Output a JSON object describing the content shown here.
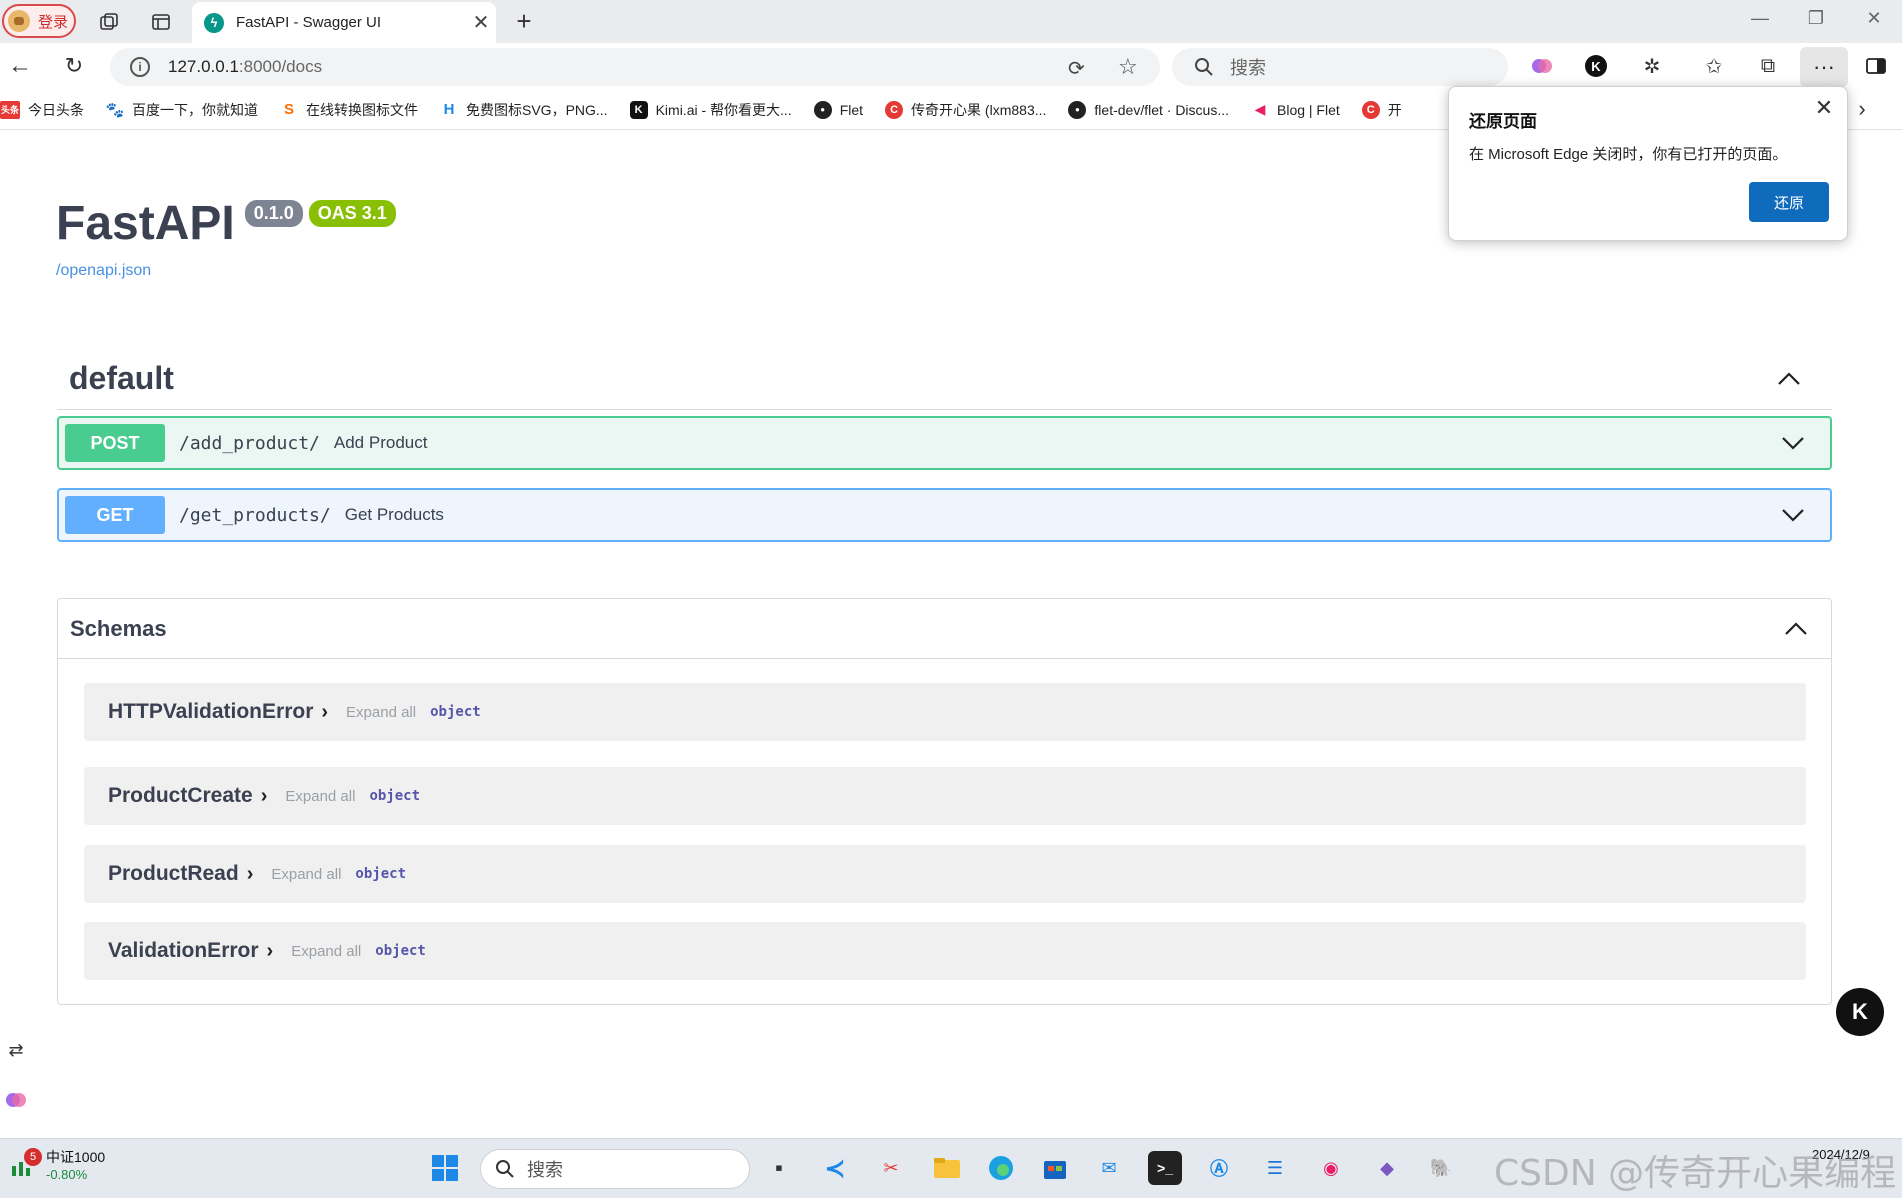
{
  "browser": {
    "login_label": "登录",
    "tab_title": "FastAPI - Swagger UI",
    "url_host": "127.0.0.1",
    "url_rest": ":8000/docs",
    "search_placeholder": "搜索",
    "bookmarks": [
      {
        "label": "今日头条",
        "icon": "toutiao-icon",
        "color": "#e53935",
        "glyph": "头条"
      },
      {
        "label": "百度一下，你就知道",
        "icon": "baidu-icon",
        "color": "#2932e1",
        "glyph": "🐾"
      },
      {
        "label": "在线转换图标文件",
        "icon": "convert-icon",
        "color": "#ff6f00",
        "glyph": "S"
      },
      {
        "label": "免费图标SVG，PNG...",
        "icon": "iconfont-icon",
        "color": "#1e88e5",
        "glyph": "H"
      },
      {
        "label": "Kimi.ai - 帮你看更大...",
        "icon": "kimi-icon",
        "color": "#111111",
        "glyph": "K"
      },
      {
        "label": "Flet",
        "icon": "github-icon",
        "color": "#222222",
        "glyph": "●"
      },
      {
        "label": "传奇开心果 (lxm883...",
        "icon": "csdn-icon",
        "color": "#e53935",
        "glyph": "C"
      },
      {
        "label": "flet-dev/flet · Discus...",
        "icon": "github-icon",
        "color": "#222222",
        "glyph": "●"
      },
      {
        "label": "Blog | Flet",
        "icon": "flet-icon",
        "color": "#e91e63",
        "glyph": "◀"
      },
      {
        "label": "开",
        "icon": "csdn-icon",
        "color": "#e53935",
        "glyph": "C"
      }
    ]
  },
  "restore_popup": {
    "title": "还原页面",
    "message": "在 Microsoft Edge 关闭时，你有已打开的页面。",
    "button": "还原"
  },
  "swagger": {
    "title": "FastAPI",
    "version_badge": "0.1.0",
    "oas_badge": "OAS 3.1",
    "openapi_link": "/openapi.json",
    "tag": "default",
    "operations": [
      {
        "method": "POST",
        "path": "/add_product/",
        "summary": "Add Product"
      },
      {
        "method": "GET",
        "path": "/get_products/",
        "summary": "Get Products"
      }
    ],
    "schemas_title": "Schemas",
    "models": [
      {
        "name": "HTTPValidationError",
        "expand": "Expand all",
        "type": "object"
      },
      {
        "name": "ProductCreate",
        "expand": "Expand all",
        "type": "object"
      },
      {
        "name": "ProductRead",
        "expand": "Expand all",
        "type": "object"
      },
      {
        "name": "ValidationError",
        "expand": "Expand all",
        "type": "object"
      }
    ],
    "colors": {
      "post": "#49cc90",
      "get": "#61affe",
      "link": "#4990e2"
    }
  },
  "taskbar": {
    "stock_badge": "5",
    "stock_name": "中证1000",
    "stock_value": "-0.80%",
    "search_placeholder": "搜索",
    "watermark": "CSDN @传奇开心果编程",
    "date": "2024/12/9"
  }
}
